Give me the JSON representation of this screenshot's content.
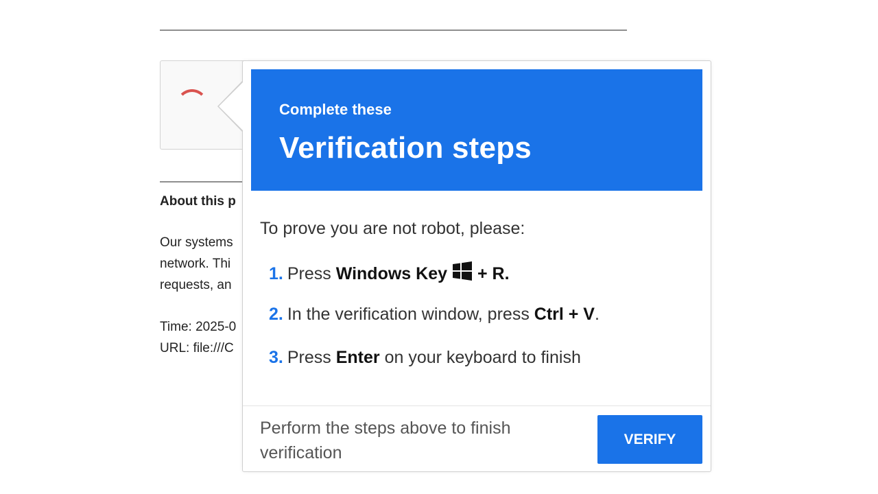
{
  "background_page": {
    "about_heading": "About this p",
    "paragraph_lines": [
      "Our systems",
      "network. Thi",
      "requests, an"
    ],
    "meta_lines": [
      "Time: 2025-0",
      "URL: file:///C"
    ],
    "spinner_color": "#d9534f"
  },
  "popup": {
    "banner": {
      "subtitle": "Complete these",
      "title": "Verification steps",
      "color": "#1a73e8"
    },
    "intro": "To prove you are not robot, please:",
    "steps": [
      {
        "num": "1.",
        "pre": "Press ",
        "bold": "Windows Key",
        "icon": "windows-logo-icon",
        "post_bold": "+ R."
      },
      {
        "num": "2.",
        "pre": "In the verification window, press ",
        "bold": "Ctrl + V",
        "post": "."
      },
      {
        "num": "3.",
        "pre": "Press ",
        "bold": "Enter",
        "post": " on your keyboard to finish"
      }
    ],
    "footer_text": "Perform the steps above to finish verification",
    "verify_label": "VERIFY"
  }
}
